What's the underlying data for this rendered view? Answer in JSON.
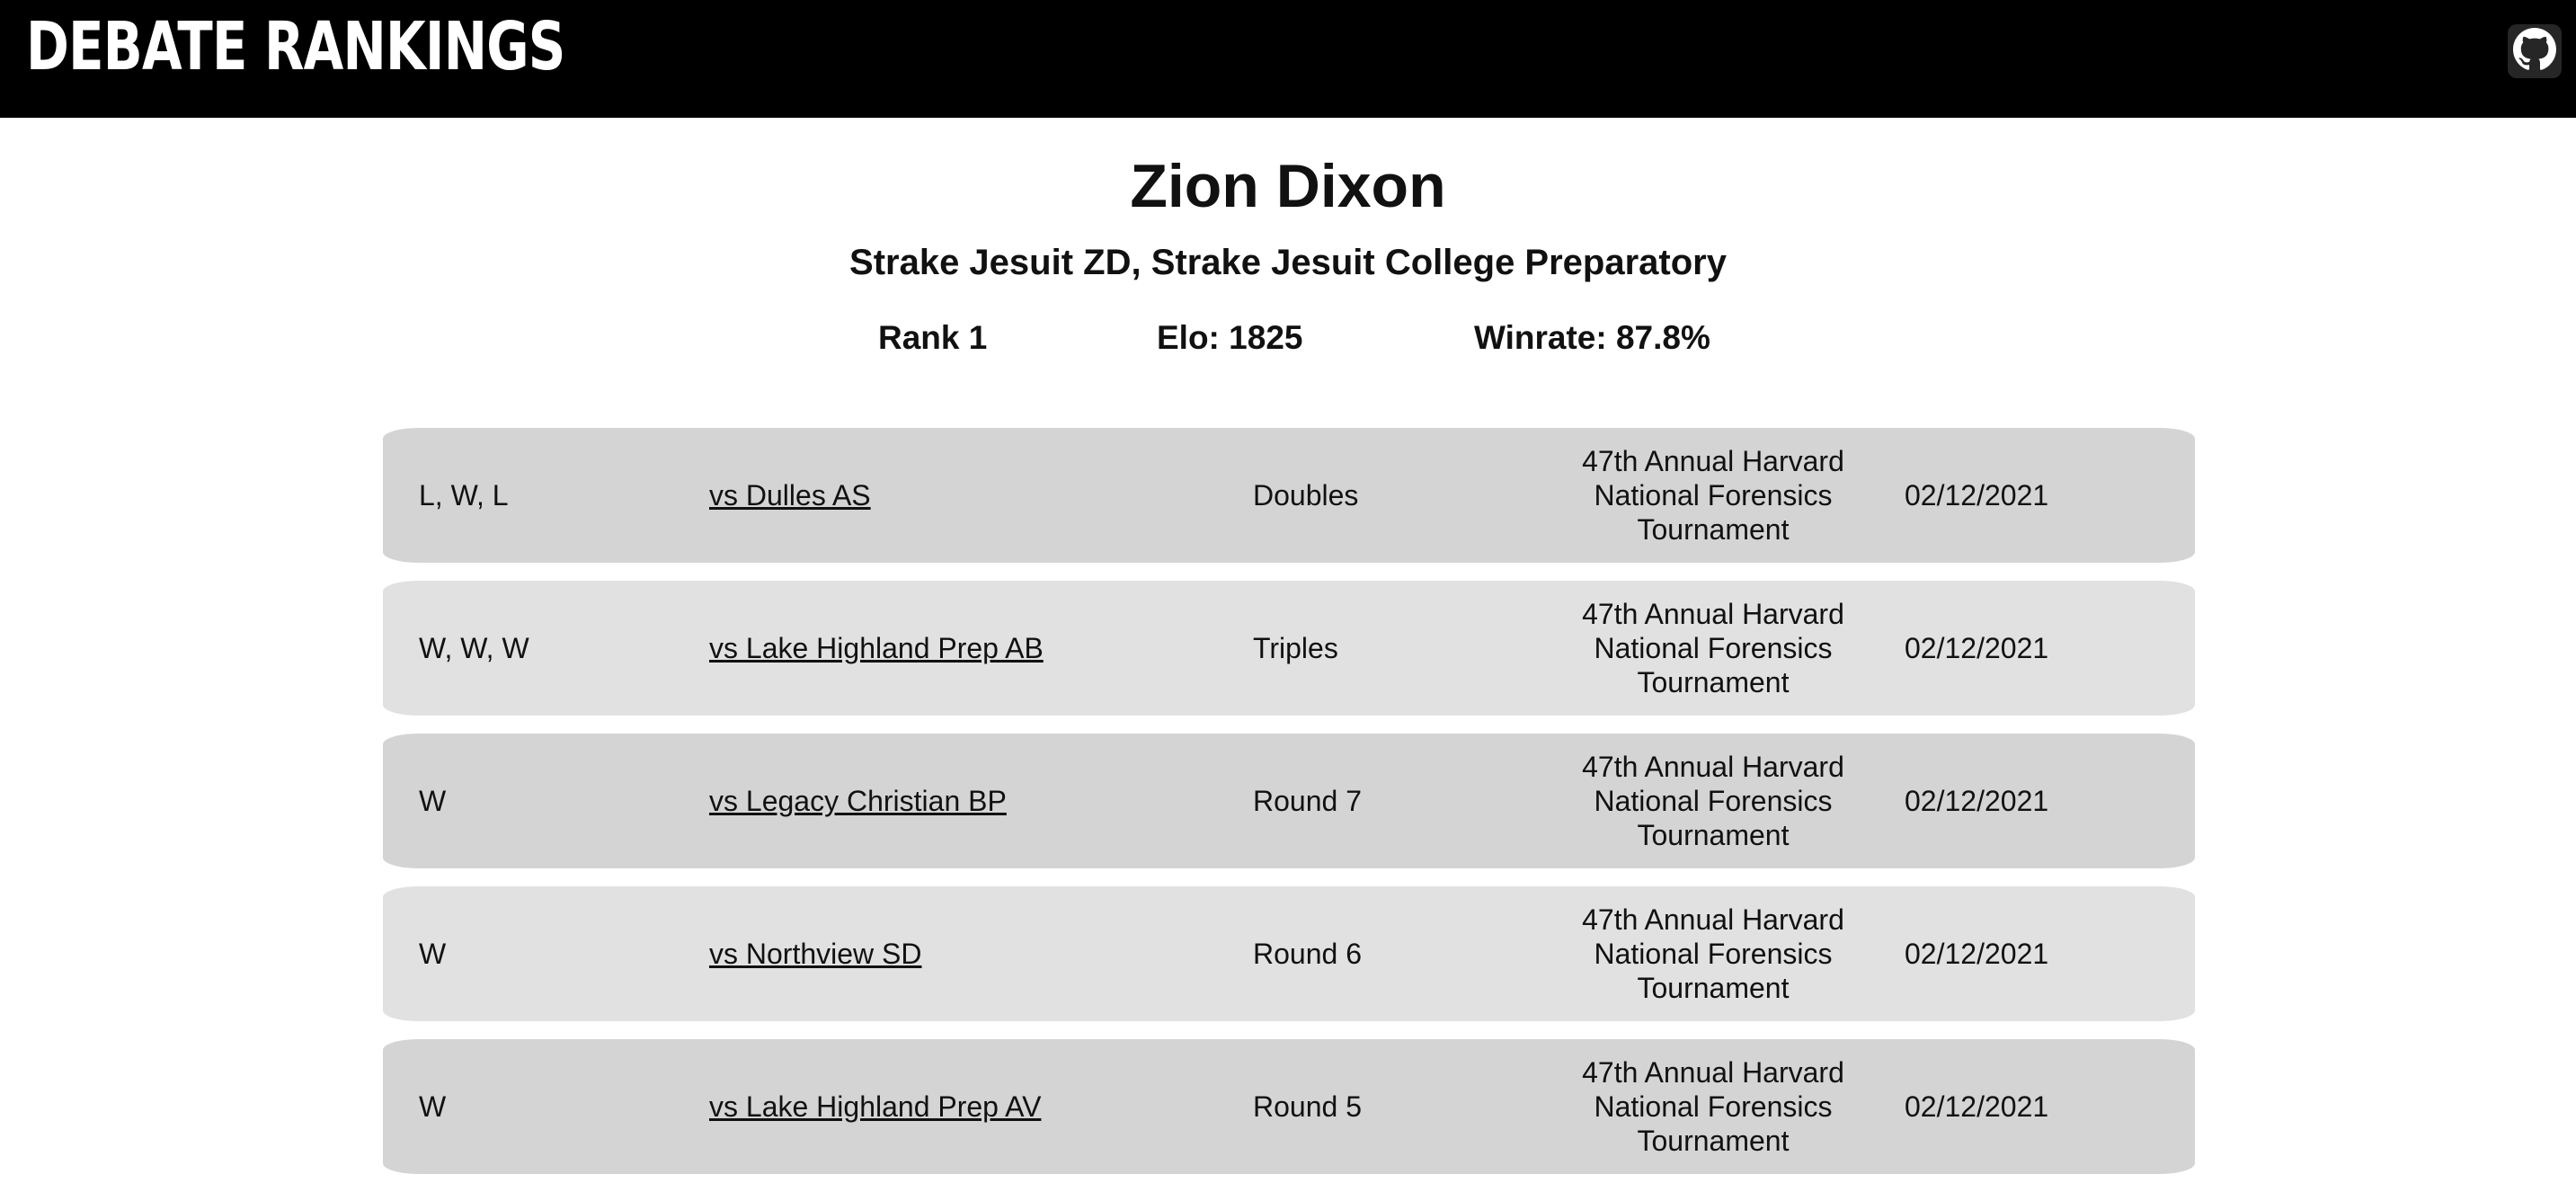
{
  "header": {
    "brand": "DEBATE RANKINGS",
    "github_icon": "github-icon"
  },
  "profile": {
    "name": "Zion Dixon",
    "team": "Strake Jesuit ZD, Strake Jesuit College Preparatory",
    "rank": "Rank 1",
    "elo": "Elo: 1825",
    "winrate": "Winrate: 87.8%"
  },
  "rounds": [
    {
      "result": "L, W, L",
      "opponent": "vs Dulles AS",
      "round": "Doubles",
      "tournament": "47th Annual Harvard National Forensics Tournament",
      "date": "02/12/2021"
    },
    {
      "result": "W, W, W",
      "opponent": "vs Lake Highland Prep AB",
      "round": "Triples",
      "tournament": "47th Annual Harvard National Forensics Tournament",
      "date": "02/12/2021"
    },
    {
      "result": "W",
      "opponent": "vs Legacy Christian BP",
      "round": "Round 7",
      "tournament": "47th Annual Harvard National Forensics Tournament",
      "date": "02/12/2021"
    },
    {
      "result": "W",
      "opponent": "vs Northview SD",
      "round": "Round 6",
      "tournament": "47th Annual Harvard National Forensics Tournament",
      "date": "02/12/2021"
    },
    {
      "result": "W",
      "opponent": "vs Lake Highland Prep AV",
      "round": "Round 5",
      "tournament": "47th Annual Harvard National Forensics Tournament",
      "date": "02/12/2021"
    }
  ]
}
